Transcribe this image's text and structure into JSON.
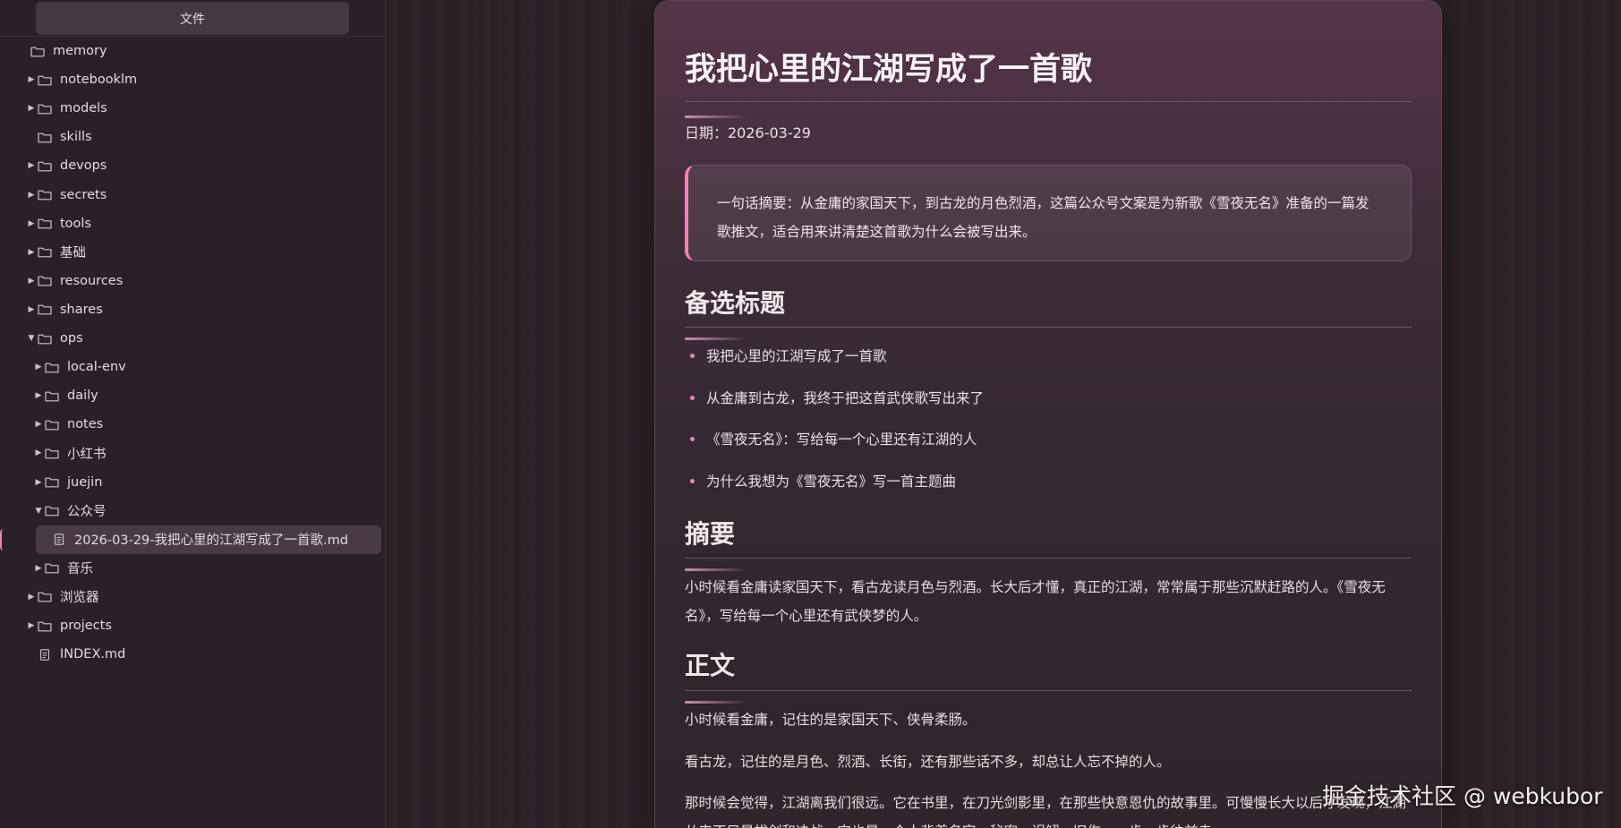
{
  "sidebar": {
    "header": "文件",
    "items": [
      {
        "label": "memory",
        "arrow": "",
        "type": "folder",
        "indent": 0
      },
      {
        "label": "notebooklm",
        "arrow": "right",
        "type": "folder",
        "indent": 1
      },
      {
        "label": "models",
        "arrow": "right",
        "type": "folder",
        "indent": 1
      },
      {
        "label": "skills",
        "arrow": "",
        "type": "folder",
        "indent": 1
      },
      {
        "label": "devops",
        "arrow": "right",
        "type": "folder",
        "indent": 1
      },
      {
        "label": "secrets",
        "arrow": "right",
        "type": "folder",
        "indent": 1
      },
      {
        "label": "tools",
        "arrow": "right",
        "type": "folder",
        "indent": 1
      },
      {
        "label": "基础",
        "arrow": "right",
        "type": "folder",
        "indent": 1
      },
      {
        "label": "resources",
        "arrow": "right",
        "type": "folder",
        "indent": 1
      },
      {
        "label": "shares",
        "arrow": "right",
        "type": "folder",
        "indent": 1
      },
      {
        "label": "ops",
        "arrow": "down",
        "type": "folder",
        "indent": 1
      },
      {
        "label": "local-env",
        "arrow": "right",
        "type": "folder",
        "indent": 2
      },
      {
        "label": "daily",
        "arrow": "right",
        "type": "folder",
        "indent": 2
      },
      {
        "label": "notes",
        "arrow": "right",
        "type": "folder",
        "indent": 2
      },
      {
        "label": "小红书",
        "arrow": "right",
        "type": "folder",
        "indent": 2
      },
      {
        "label": "juejin",
        "arrow": "right",
        "type": "folder",
        "indent": 2
      },
      {
        "label": "公众号",
        "arrow": "down",
        "type": "folder",
        "indent": 2
      },
      {
        "label": "2026-03-29-我把心里的江湖写成了一首歌.md",
        "arrow": "",
        "type": "file",
        "indent": 3,
        "active": true
      },
      {
        "label": "音乐",
        "arrow": "right",
        "type": "folder",
        "indent": 2
      },
      {
        "label": "浏览器",
        "arrow": "right",
        "type": "folder",
        "indent": 1
      },
      {
        "label": "projects",
        "arrow": "right",
        "type": "folder",
        "indent": 1
      },
      {
        "label": "INDEX.md",
        "arrow": "",
        "type": "file",
        "indent": 1
      }
    ]
  },
  "doc": {
    "title": "我把心里的江湖写成了一首歌",
    "date": "日期：2026-03-29",
    "summary_quote": "一句话摘要：从金庸的家国天下，到古龙的月色烈酒，这篇公众号文案是为新歌《雪夜无名》准备的一篇发歌推文，适合用来讲清楚这首歌为什么会被写出来。",
    "h_titles": "备选标题",
    "titles": [
      "我把心里的江湖写成了一首歌",
      "从金庸到古龙，我终于把这首武侠歌写出来了",
      "《雪夜无名》：写给每一个心里还有江湖的人",
      "为什么我想为《雪夜无名》写一首主题曲"
    ],
    "h_abstract": "摘要",
    "abstract": "小时候看金庸读家国天下，看古龙读月色与烈酒。长大后才懂，真正的江湖，常常属于那些沉默赶路的人。《雪夜无名》，写给每一个心里还有武侠梦的人。",
    "h_body": "正文",
    "body": [
      "小时候看金庸，记住的是家国天下、侠骨柔肠。",
      "看古龙，记住的是月色、烈酒、长街，还有那些话不多，却总让人忘不掉的人。",
      "那时候会觉得，江湖离我们很远。它在书里，在刀光剑影里，在那些快意恩仇的故事里。可慢慢长大以后才发现，江湖从来不只是拔剑和决战，它也是一个人背着名字、秘密、误解、旧伤，一步一步往前走。"
    ]
  },
  "watermark": "掘金技术社区 @ webkubor"
}
